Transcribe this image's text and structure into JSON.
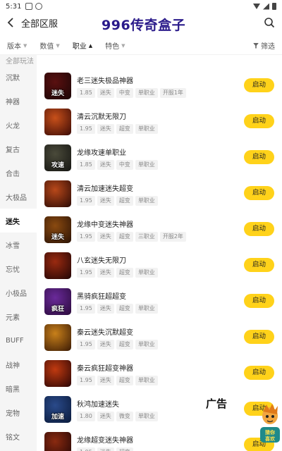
{
  "status_bar": {
    "time": "5:31"
  },
  "header": {
    "back_icon": "back-arrow-icon",
    "title": "全部区服",
    "watermark": "996传奇盒子",
    "search_icon": "search-icon"
  },
  "filters": [
    {
      "label": "版本",
      "active": false
    },
    {
      "label": "数值",
      "active": false
    },
    {
      "label": "职业",
      "active": true,
      "chevron": "▲"
    },
    {
      "label": "特色",
      "active": false
    }
  ],
  "filter_chevron": "▼",
  "screen_label": "筛选",
  "sidebar": {
    "top_cut": "全部玩法",
    "items": [
      "沉默",
      "神器",
      "火龙",
      "复古",
      "合击",
      "大极品",
      "迷失",
      "冰雪",
      "忘忧",
      "小极品",
      "元素",
      "BUFF",
      "战神",
      "暗黑",
      "宠物",
      "铭文"
    ],
    "active": "迷失"
  },
  "button_label": "启动",
  "games": [
    {
      "name": "老三迷失极品神器",
      "tags": [
        "1.85",
        "迷失",
        "中变",
        "单职业",
        "开服1年"
      ],
      "thumb_text": "迷失",
      "c1": "#5a1010",
      "c2": "#1a0606"
    },
    {
      "name": "清云沉默无限刀",
      "tags": [
        "1.95",
        "迷失",
        "超变",
        "单职业"
      ],
      "thumb_text": "",
      "c1": "#c8501a",
      "c2": "#3a0a06"
    },
    {
      "name": "龙缘攻速单职业",
      "tags": [
        "1.85",
        "迷失",
        "中变",
        "单职业"
      ],
      "thumb_text": "攻速",
      "c1": "#4a4a3a",
      "c2": "#151512"
    },
    {
      "name": "清云加速迷失超变",
      "tags": [
        "1.95",
        "迷失",
        "超变",
        "单职业"
      ],
      "thumb_text": "",
      "c1": "#b8481a",
      "c2": "#2a0a05"
    },
    {
      "name": "龙缘中变迷失神器",
      "tags": [
        "1.95",
        "迷失",
        "超变",
        "三职业",
        "开服2年"
      ],
      "thumb_text": "迷失",
      "c1": "#8a4a10",
      "c2": "#2a1205"
    },
    {
      "name": "八玄迷失无限刀",
      "tags": [
        "1.95",
        "迷失",
        "超变",
        "单职业"
      ],
      "thumb_text": "",
      "c1": "#9a2a10",
      "c2": "#200505"
    },
    {
      "name": "黑骑疯狂超超变",
      "tags": [
        "1.95",
        "迷失",
        "超变",
        "单职业"
      ],
      "thumb_text": "疯狂",
      "c1": "#6a2a9a",
      "c2": "#2a0a3a"
    },
    {
      "name": "秦云迷失沉默超变",
      "tags": [
        "1.95",
        "迷失",
        "超变",
        "单职业"
      ],
      "thumb_text": "",
      "c1": "#c8801a",
      "c2": "#3a1a05"
    },
    {
      "name": "秦云疯狂超变神器",
      "tags": [
        "1.95",
        "迷失",
        "超变",
        "单职业"
      ],
      "thumb_text": "",
      "c1": "#c03a10",
      "c2": "#2a0505"
    },
    {
      "name": "秋鸿加速迷失",
      "tags": [
        "1.80",
        "迷失",
        "微变",
        "单职业"
      ],
      "thumb_text": "加速",
      "c1": "#2a4a8a",
      "c2": "#0a1a3a"
    },
    {
      "name": "龙缘超变迷失神器",
      "tags": [
        "1.95",
        "迷失",
        "超变"
      ],
      "thumb_text": "",
      "c1": "#8a2a10",
      "c2": "#200505"
    }
  ],
  "ad_label": "广告",
  "mascot_text": "猜你喜欢"
}
